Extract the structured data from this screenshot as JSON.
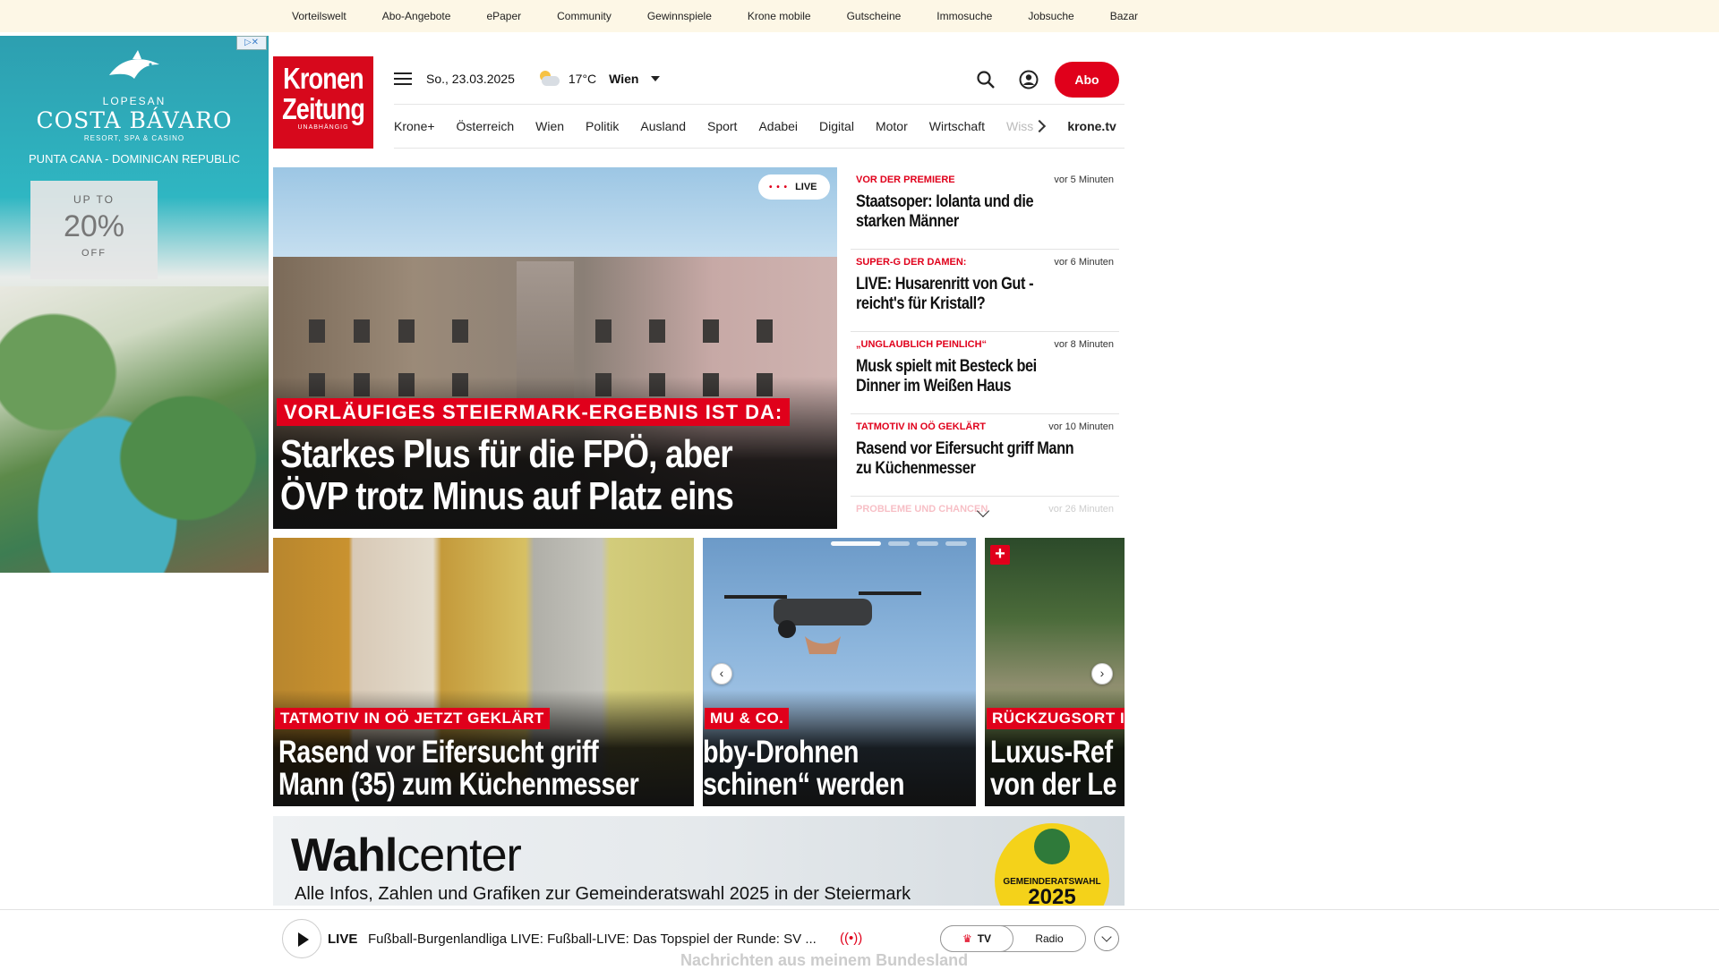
{
  "topbar": {
    "links": [
      "Vorteilswelt",
      "Abo-Angebote",
      "ePaper",
      "Community",
      "Gewinnspiele",
      "Krone mobile",
      "Gutscheine",
      "Immosuche",
      "Jobsuche",
      "Bazar"
    ]
  },
  "ad": {
    "brand_line1": "LOPESAN",
    "brand_line2": "COSTA BÁVARO",
    "brand_line3": "RESORT, SPA & CASINO",
    "location": "PUNTA CANA - DOMINICAN REPUBLIC",
    "offer_top": "UP TO",
    "offer_value": "20%",
    "offer_bottom": "OFF",
    "badge": "▷✕"
  },
  "logo": {
    "line1": "Kronen",
    "line2": "Zeitung",
    "tagline": "UNABHÄNGIG"
  },
  "header": {
    "date": "So., 23.03.2025",
    "temperature": "17°C",
    "city": "Wien",
    "abo_label": "Abo"
  },
  "nav": {
    "items": [
      "Krone+",
      "Österreich",
      "Wien",
      "Politik",
      "Ausland",
      "Sport",
      "Adabei",
      "Digital",
      "Motor",
      "Wirtschaft"
    ],
    "faded_item": "Wiss",
    "tv_link": "krone.tv"
  },
  "hero": {
    "live_label": "LIVE",
    "kicker": "VORLÄUFIGES STEIERMARK-ERGEBNIS IST DA:",
    "headline_line1": "Starkes Plus für die FPÖ, aber",
    "headline_line2": "ÖVP trotz Minus auf Platz eins"
  },
  "sidebar": {
    "stories": [
      {
        "category": "VOR DER PREMIERE",
        "time": "vor 5 Minuten",
        "title_line1": "Staatsoper: Iolanta und die",
        "title_line2": "starken Männer"
      },
      {
        "category": "SUPER-G DER DAMEN:",
        "time": "vor 6 Minuten",
        "title_line1": "LIVE: Husarenritt von Gut -",
        "title_line2": "reicht's für Kristall?"
      },
      {
        "category": "„UNGLAUBLICH PEINLICH“",
        "time": "vor 8 Minuten",
        "title_line1": "Musk spielt mit Besteck bei",
        "title_line2": "Dinner im Weißen Haus"
      },
      {
        "category": "TATMOTIV IN OÖ GEKLÄRT",
        "time": "vor 10 Minuten",
        "title_line1": "Rasend vor Eifersucht griff Mann",
        "title_line2": "zu Küchenmesser"
      }
    ],
    "faded_story": {
      "category": "PROBLEME UND CHANCEN",
      "time": "vor 26 Minuten"
    }
  },
  "cards": [
    {
      "kicker": "TATMOTIV IN OÖ JETZT GEKLÄRT",
      "line1": "Rasend vor Eifersucht griff",
      "line2": "Mann (35) zum Küchenmesser"
    },
    {
      "kicker": "MU & CO.",
      "line1": "bby-Drohnen",
      "line2": "schinen“ werden"
    },
    {
      "kicker": "RÜCKZUGSORT IN",
      "line1": "Luxus-Ref",
      "line2": "von der Le",
      "plus": "+"
    }
  ],
  "carousel": {
    "prev": "‹",
    "next": "›",
    "active_slide": 1,
    "slide_count": 4
  },
  "wahlcenter": {
    "title_bold": "Wahl",
    "title_rest": "center",
    "subtitle": "Alle Infos, Zahlen und Grafiken zur Gemeinderatswahl 2025 in der Steiermark",
    "seal_line1": "GEMEINDERATSWAHL",
    "seal_year": "2025"
  },
  "player": {
    "live_label": "LIVE",
    "text": "Fußball-Burgenlandliga LIVE: Fußball-LIVE: Das Topspiel der Runde: SV ...",
    "tv_label": "TV",
    "radio_label": "Radio",
    "below_text": "Nachrichten aus meinem Bundesland"
  },
  "colors": {
    "brand_red": "#e0001b",
    "topbar_bg": "#fdf7e6"
  }
}
